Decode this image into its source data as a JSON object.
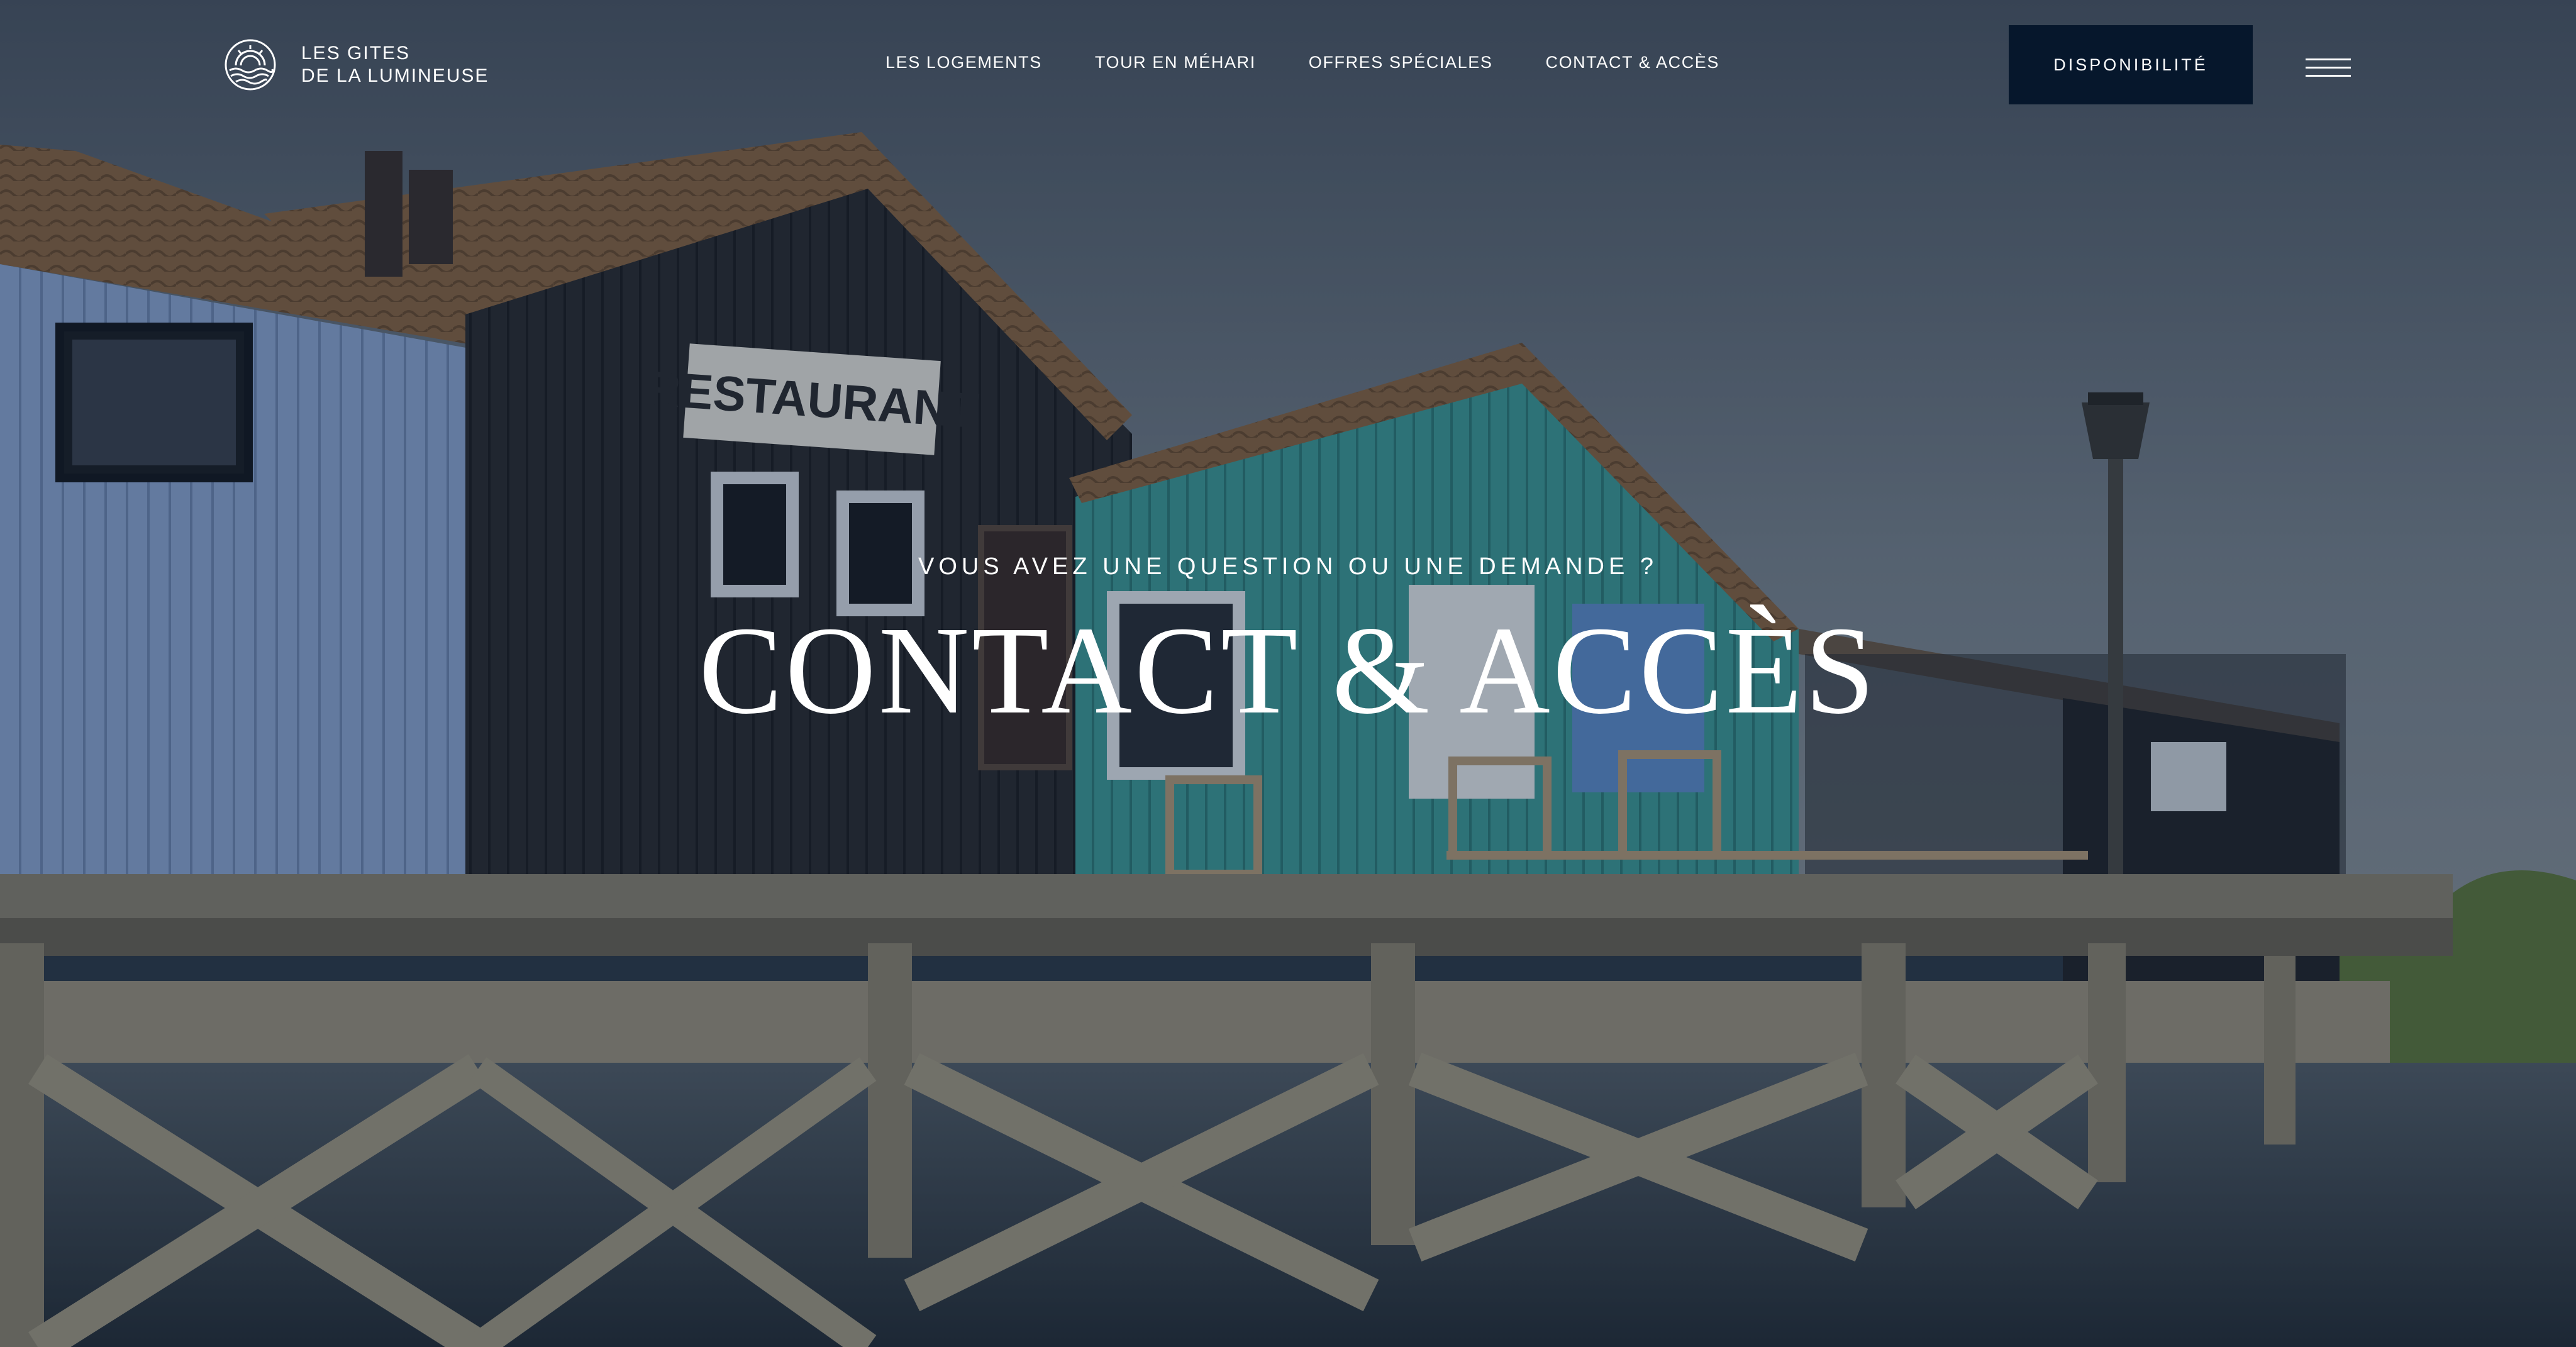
{
  "brand": {
    "line1": "LES GITES",
    "line2": "DE LA LUMINEUSE",
    "icon": "sunrise-waves-icon"
  },
  "nav": {
    "items": [
      {
        "label": "LES LOGEMENTS"
      },
      {
        "label": "TOUR EN MÉHARI"
      },
      {
        "label": "OFFRES SPÉCIALES"
      },
      {
        "label": "CONTACT & ACCÈS"
      }
    ]
  },
  "header": {
    "cta_label": "DISPONIBILITÉ",
    "menu_icon": "hamburger-menu-icon"
  },
  "hero": {
    "eyebrow": "VOUS AVEZ UNE QUESTION OU UNE DEMANDE ?",
    "title": "CONTACT & ACCÈS",
    "sign_text": "RESTAURANT"
  },
  "colors": {
    "cta_background": "#06172c",
    "overlay": "#0a1a30",
    "text": "#ffffff"
  }
}
